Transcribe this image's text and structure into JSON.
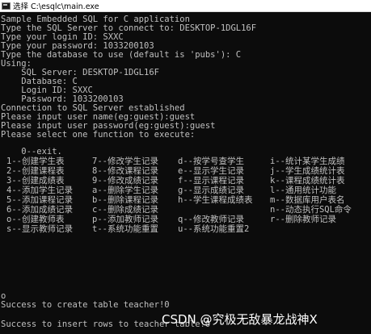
{
  "window": {
    "title": "选择 C:\\esqlc\\main.exe"
  },
  "console": {
    "lines": [
      "Sample Embedded SQL for C application",
      "Type the SQL Server to connect to: DESKTOP-1DGL16F",
      "Type your login ID: SXXC",
      "Type your password: 1033200103",
      "Type the database to use (default is 'pubs'): C",
      "Using:",
      "    SQL Server: DESKTOP-1DGL16F",
      "    Database: C",
      "    Login ID: SXXC",
      "    Password: 1033200103",
      "Connection to SQL Server established",
      "Please input user name(eg:guest):guest",
      "Please input user password(eg:guest):guest",
      "Please select one function to execute:",
      "",
      "    0--exit."
    ],
    "menu": [
      [
        "1--创建学生表",
        "7--修改学生记录",
        "d--按学号查学生",
        "i--统计某学生成绩"
      ],
      [
        "2--创建课程表",
        "8--修改课程记录",
        "e--显示学生记录",
        "j--学生成绩统计表"
      ],
      [
        "3--创建成绩表",
        "9--修改成绩记录",
        "f--显示课程记录",
        "k--课程成绩统计表"
      ],
      [
        "4--添加学生记录",
        "a--删除学生记录",
        "g--显示成绩记录",
        "l--通用统计功能"
      ],
      [
        "5--添加课程记录",
        "b--删除课程记录",
        "h--学生课程成绩表",
        "m--数据库用户表名"
      ],
      [
        "6--添加成绩记录",
        "c--删除成绩记录",
        "",
        "n--动态执行SQL命令"
      ],
      [
        "o--创建教师表",
        "p--添加教师记录",
        "q--修改教师记录",
        "r--删除教师记录"
      ],
      [
        "s--显示教师记录",
        "t--系统功能重置",
        "u--系统功能重置2",
        ""
      ]
    ],
    "input_value": "o",
    "result_1": "Success to create table teacher!0",
    "result_2": "Success to insert rows to teacher table!0"
  },
  "watermark": "CSDN @究极无敌暴龙战神X",
  "colors": {
    "console_bg": "#0c0c0c",
    "console_text": "#c0c0c0",
    "titlebar_bg": "#ffffff"
  }
}
